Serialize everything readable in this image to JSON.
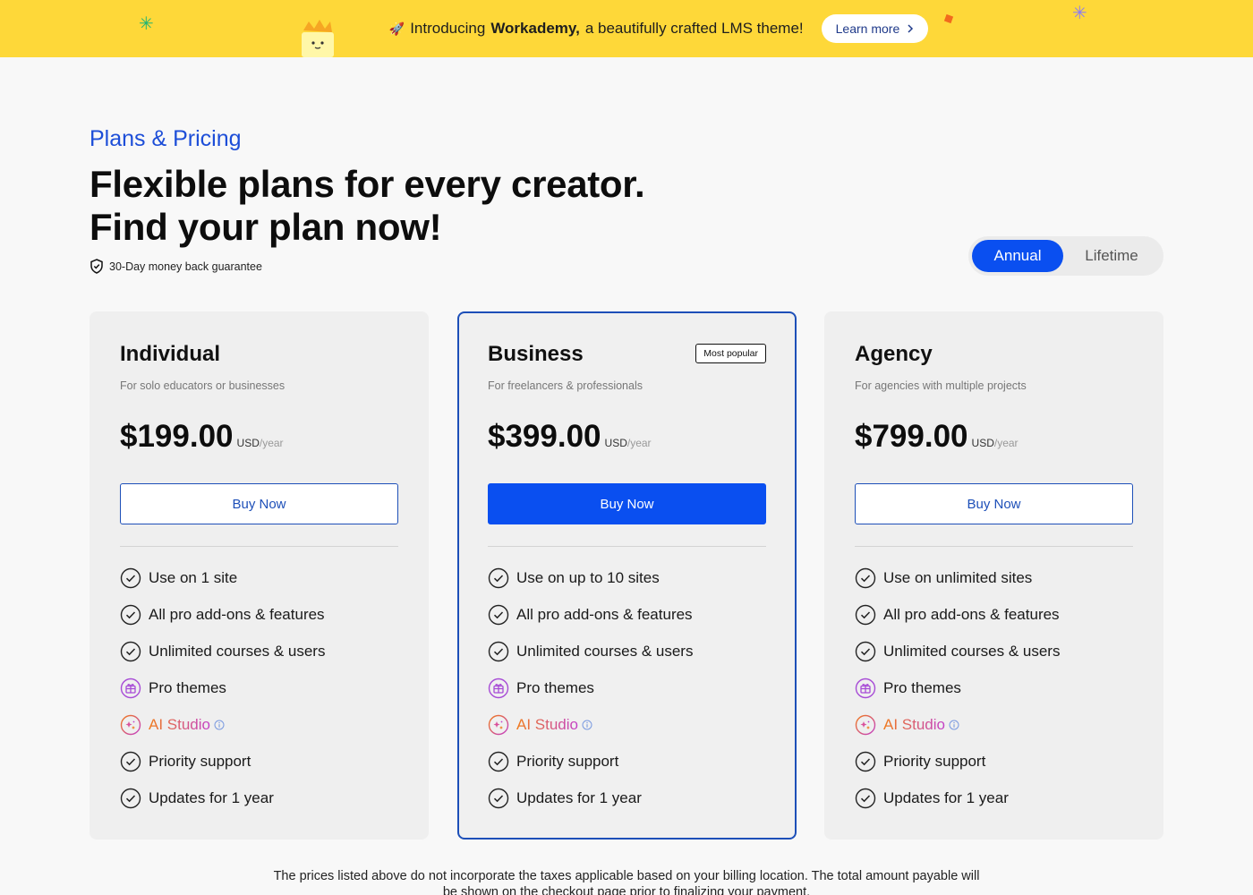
{
  "banner": {
    "prefix": "Introducing",
    "brand": "Workademy,",
    "suffix": "a beautifully crafted LMS theme!",
    "learn_more": "Learn more",
    "colors": {
      "background": "#fed839"
    }
  },
  "header": {
    "eyebrow": "Plans & Pricing",
    "headline_line1": "Flexible plans for every creator.",
    "headline_line2": "Find your plan now!",
    "guarantee": "30-Day money back guarantee"
  },
  "billing_toggle": {
    "options": [
      "Annual",
      "Lifetime"
    ],
    "selected": "Annual"
  },
  "plans": [
    {
      "name": "Individual",
      "description": "For solo educators or businesses",
      "price": "$199.00",
      "currency": "USD",
      "period": "/year",
      "cta": "Buy Now",
      "features": [
        "Use on 1 site",
        "All pro add-ons & features",
        "Unlimited courses & users",
        "Pro themes",
        "AI Studio",
        "Priority support",
        "Updates for 1 year"
      ]
    },
    {
      "name": "Business",
      "badge": "Most popular",
      "description": "For freelancers & professionals",
      "price": "$399.00",
      "currency": "USD",
      "period": "/year",
      "cta": "Buy Now",
      "features": [
        "Use on up to 10 sites",
        "All pro add-ons & features",
        "Unlimited courses & users",
        "Pro themes",
        "AI Studio",
        "Priority support",
        "Updates for 1 year"
      ]
    },
    {
      "name": "Agency",
      "description": "For agencies with multiple projects",
      "price": "$799.00",
      "currency": "USD",
      "period": "/year",
      "cta": "Buy Now",
      "features": [
        "Use on unlimited sites",
        "All pro add-ons & features",
        "Unlimited courses & users",
        "Pro themes",
        "AI Studio",
        "Priority support",
        "Updates for 1 year"
      ]
    }
  ],
  "footnote": "The prices listed above do not incorporate the taxes applicable based on your billing location. The total amount payable will be shown on the checkout page prior to finalizing your payment.",
  "colors": {
    "accent": "#0a4ff0",
    "eyebrow": "#1d4ed8",
    "card_bg": "#efefef"
  }
}
